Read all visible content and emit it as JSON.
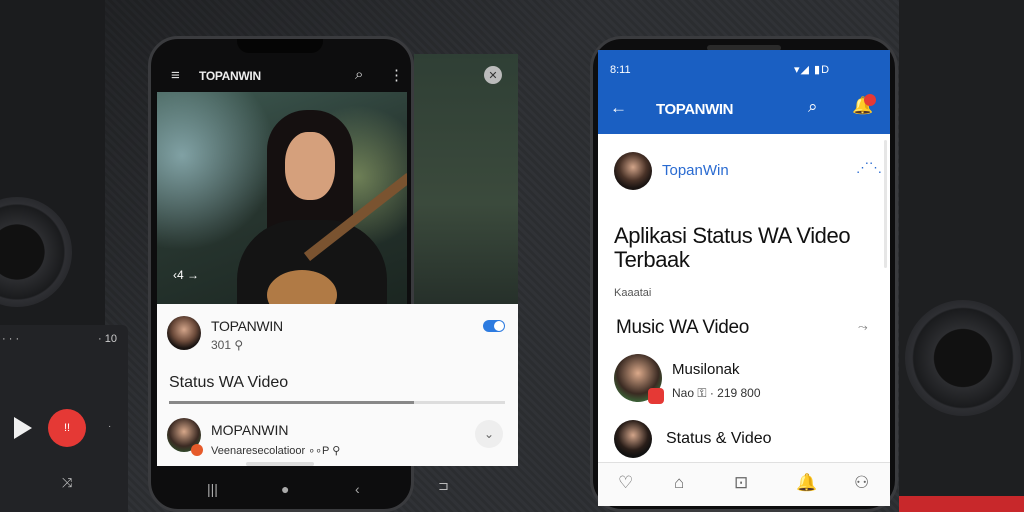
{
  "left_player": {
    "dots": "· · ·",
    "time": "· 10",
    "play_icon": "play-icon",
    "record_label": "!!",
    "next_icon": "·",
    "shuffle": "⤨"
  },
  "phone1": {
    "app_title": "TOPANWIN",
    "menu_icon": "≡",
    "search_icon": "⌕",
    "more_icon": "⋮",
    "video_overlay_time": "‹4 →",
    "fab_label": "ᐟᐟ",
    "side_close": "✕",
    "channel": {
      "name": "TOPANWIN",
      "sub": "301 ⚲"
    },
    "status_title": "Status WA Video",
    "progress": 0.73,
    "row2": {
      "name": "MOPANWIN",
      "sub": "Veenaresecolatioor ∘∘P ⚲"
    },
    "chevron": "⌄",
    "nav": [
      "|||",
      "●",
      "‹"
    ],
    "extra_icon": "⊐"
  },
  "phone2": {
    "status_time": "8:11",
    "status_icons": "▾◢ ▮D",
    "title": "TOPANWIN",
    "back_icon": "←",
    "search_icon": "⌕",
    "bell_icon": "🔔",
    "channel": "TopanWin",
    "expand_icon": "⋰⋱",
    "headline": "Aplikasi Status WA Video Terbaak",
    "category": "Kaaatai",
    "subheading": "Music WA Video",
    "sub_icon": "⤳",
    "item1": {
      "name": "Musilonak",
      "sub": "Nao ⚿ · 219 800"
    },
    "item2": "Status & Video",
    "bottom_nav": [
      "♡",
      "⌂",
      "⊡",
      "🔔",
      "⚇"
    ]
  }
}
